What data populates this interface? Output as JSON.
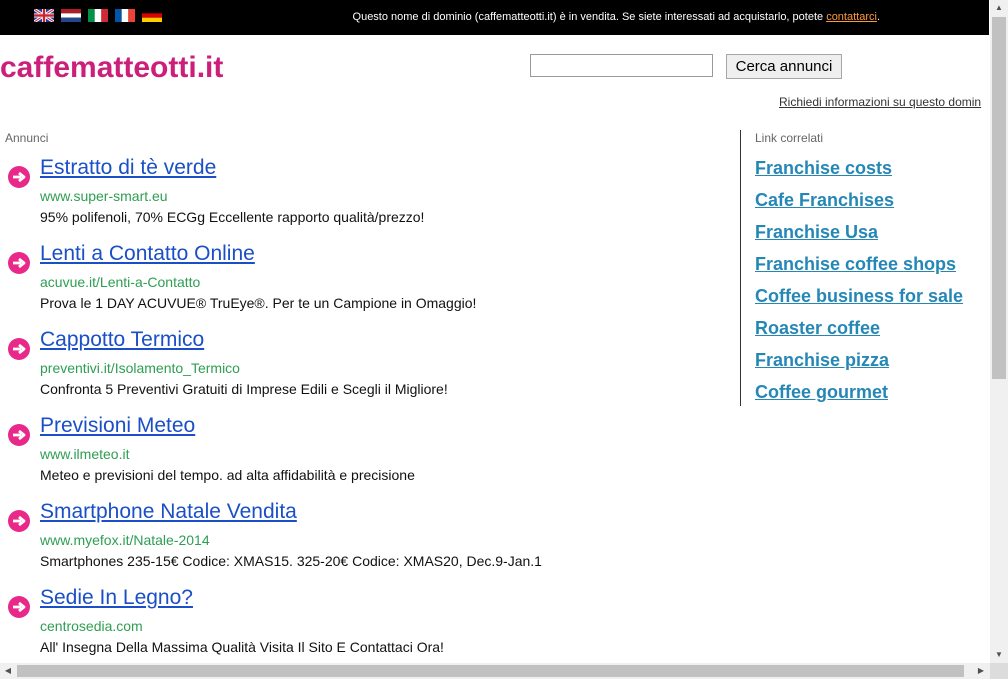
{
  "topbar": {
    "message": "Questo nome di dominio (caffematteotti.it) è in vendita. Se siete interessati ad acquistarlo, potete ",
    "contact_link": "contattarci",
    "message_end": ".",
    "flags": [
      {
        "name": "uk-flag-icon"
      },
      {
        "name": "netherlands-flag-icon"
      },
      {
        "name": "italy-flag-icon"
      },
      {
        "name": "france-flag-icon"
      },
      {
        "name": "germany-flag-icon"
      }
    ]
  },
  "header": {
    "site_title": "caffematteotti.it",
    "search_value": "",
    "search_button": "Cerca annunci",
    "info_link": "Richiedi informazioni su questo domin"
  },
  "ads": {
    "heading": "Annunci",
    "items": [
      {
        "title": "Estratto di tè verde",
        "url": "www.super-smart.eu",
        "desc": "95% polifenoli, 70% ECGg Eccellente rapporto qualità/prezzo!"
      },
      {
        "title": "Lenti a Contatto Online",
        "url": "acuvue.it/Lenti-a-Contatto",
        "desc": "Prova le 1 DAY ACUVUE® TruEye®. Per te un Campione in Omaggio!"
      },
      {
        "title": "Cappotto Termico",
        "url": "preventivi.it/Isolamento_Termico",
        "desc": "Confronta 5 Preventivi Gratuiti di Imprese Edili e Scegli il Migliore!"
      },
      {
        "title": "Previsioni Meteo",
        "url": "www.ilmeteo.it",
        "desc": "Meteo e previsioni del tempo. ad alta affidabilità e precisione"
      },
      {
        "title": "Smartphone Natale Vendita",
        "url": "www.myefox.it/Natale-2014",
        "desc": "Smartphones 235-15€ Codice: XMAS15. 325-20€ Codice: XMAS20, Dec.9-Jan.1"
      },
      {
        "title": "Sedie In Legno?",
        "url": "centrosedia.com",
        "desc": "All' Insegna Della Massima Qualità Visita Il Sito E Contattaci Ora!"
      }
    ]
  },
  "related": {
    "heading": "Link correlati",
    "items": [
      "Franchise costs",
      "Cafe Franchises",
      "Franchise Usa",
      "Franchise coffee shops",
      "Coffee business for sale",
      "Roaster coffee",
      "Franchise pizza",
      "Coffee gourmet"
    ]
  },
  "colors": {
    "title_pink": "#cc1f7a",
    "ad_link_blue": "#1a4fc7",
    "ad_url_green": "#2e9e52",
    "related_link": "#2587b6",
    "arrow_pink": "#e8298a"
  }
}
